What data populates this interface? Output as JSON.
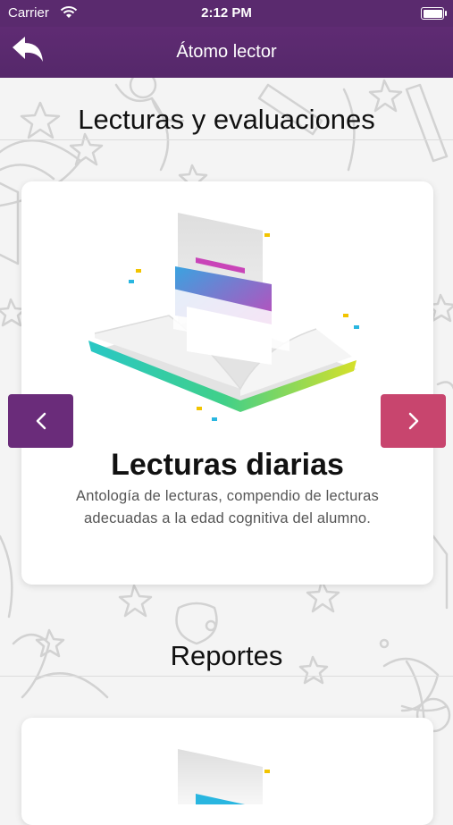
{
  "status_bar": {
    "carrier": "Carrier",
    "time": "2:12 PM"
  },
  "navbar": {
    "title": "Átomo lector",
    "back_icon": "back-arrow-icon"
  },
  "sections": {
    "lecturas": {
      "title": "Lecturas y evaluaciones"
    },
    "reportes": {
      "title": "Reportes"
    }
  },
  "carousel": {
    "card_title": "Lecturas diarias",
    "card_description": "Antología de lecturas, compendio de lecturas adecuadas a la edad cognitiva del alumno.",
    "prev_icon": "chevron-left-icon",
    "next_icon": "chevron-right-icon"
  },
  "colors": {
    "nav_purple": "#5a2a6e",
    "prev_button": "#6a2c7a",
    "next_button": "#c8456e"
  }
}
